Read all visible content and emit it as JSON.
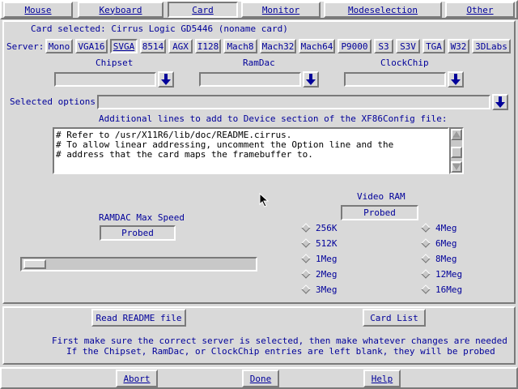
{
  "tabs": [
    {
      "label": "Mouse",
      "active": false
    },
    {
      "label": "Keyboard",
      "active": false
    },
    {
      "label": "Card",
      "active": true
    },
    {
      "label": "Monitor",
      "active": false
    },
    {
      "label": "Modeselection",
      "active": false
    },
    {
      "label": "Other",
      "active": false
    }
  ],
  "card_selected": "Card selected: Cirrus Logic GD5446 (noname card)",
  "server": {
    "label": "Server:",
    "options": [
      "Mono",
      "VGA16",
      "SVGA",
      "8514",
      "AGX",
      "I128",
      "Mach8",
      "Mach32",
      "Mach64",
      "P9000",
      "S3",
      "S3V",
      "TGA",
      "W32",
      "3DLabs"
    ],
    "selected": "SVGA"
  },
  "chipset": {
    "label": "Chipset",
    "value": ""
  },
  "ramdac": {
    "label": "RamDac",
    "value": ""
  },
  "clockchip": {
    "label": "ClockChip",
    "value": ""
  },
  "selected_options": {
    "label": "Selected options:",
    "value": ""
  },
  "additional_lines": {
    "label": "Additional lines to add to Device section of the XF86Config file:",
    "lines": [
      "# Refer to /usr/X11R6/lib/doc/README.cirrus.",
      "# To allow linear addressing, uncomment the Option line and the",
      "# address that the card maps the framebuffer to."
    ]
  },
  "ramdac_speed": {
    "label": "RAMDAC Max Speed",
    "value": "Probed"
  },
  "speed_slider": {
    "level": 0
  },
  "video_ram": {
    "label": "Video RAM",
    "value": "Probed",
    "left": [
      "256K",
      "512K",
      "1Meg",
      "2Meg",
      "3Meg"
    ],
    "right": [
      "4Meg",
      "6Meg",
      "8Meg",
      "12Meg",
      "16Meg"
    ]
  },
  "buttons": {
    "read_readme": "Read README file",
    "card_list": "Card List",
    "abort": "Abort",
    "done": "Done",
    "help": "Help"
  },
  "info": {
    "line1": "First make sure the correct server is selected, then make whatever changes are needed",
    "line2": "If the Chipset, RamDac, or ClockChip entries are left blank, they will be probed"
  },
  "colors": {
    "accent": "#00ffff",
    "text": "#00009a",
    "background": "#d9d9d9"
  }
}
